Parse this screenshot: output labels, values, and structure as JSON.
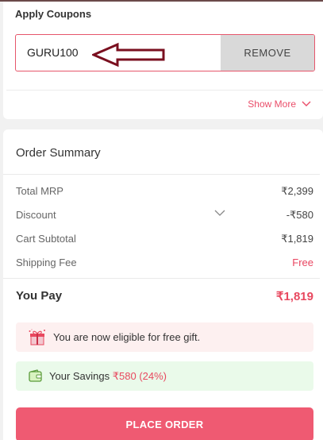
{
  "coupons": {
    "title": "Apply Coupons",
    "code": "GURU100",
    "remove_label": "REMOVE",
    "show_more": "Show More"
  },
  "summary": {
    "title": "Order Summary",
    "rows": [
      {
        "label": "Total MRP",
        "value": "₹2,399"
      },
      {
        "label": "Discount",
        "value": "-₹580"
      },
      {
        "label": "Cart Subtotal",
        "value": "₹1,819"
      },
      {
        "label": "Shipping Fee",
        "value": "Free"
      }
    ],
    "you_pay_label": "You Pay",
    "you_pay_value": "₹1,819",
    "gift_text": "You are now eligible for free gift.",
    "savings_label": "Your Savings ",
    "savings_amount": "₹580 (24%)",
    "place_order": "PLACE ORDER"
  },
  "colors": {
    "accent": "#e94560",
    "button": "#ef5a72",
    "annotation_arrow": "#7a0f1f"
  },
  "icons": {
    "chevron": "chevron-down-icon",
    "gift": "gift-icon",
    "wallet": "wallet-icon",
    "annotation": "left-arrow-icon"
  }
}
